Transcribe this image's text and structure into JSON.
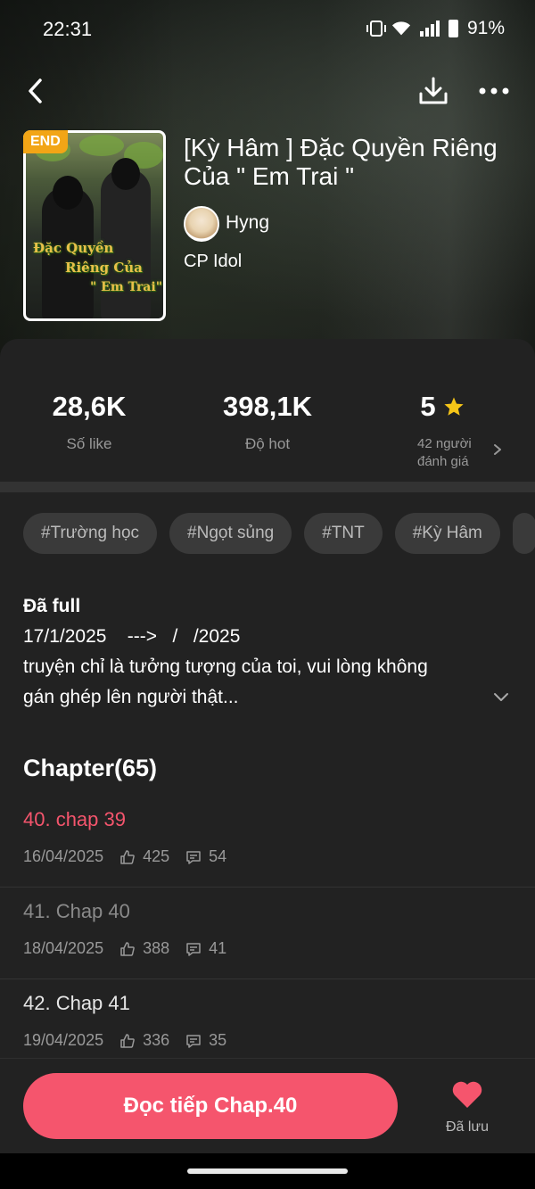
{
  "status_bar": {
    "time": "22:31",
    "battery": "91%"
  },
  "story": {
    "end_badge": "END",
    "cover_title_lines": [
      "Đặc Quyền",
      "Riêng Của",
      "\" Em Trai\""
    ],
    "title": "[Kỳ Hâm ] Đặc Quyền Riêng Của \" Em Trai \"",
    "author": "Hyng",
    "genre": "CP Idol"
  },
  "stats": {
    "likes": {
      "value": "28,6K",
      "label": "Số like"
    },
    "hot": {
      "value": "398,1K",
      "label": "Độ hot"
    },
    "rating": {
      "value": "5",
      "label_line1": "42 người",
      "label_line2": "đánh giá"
    }
  },
  "tags": [
    "#Trường học",
    "#Ngọt sủng",
    "#TNT",
    "#Kỳ Hâm"
  ],
  "description": {
    "line1": "Đã full",
    "line2": "17/1/2025    --->   /   /2025",
    "line3": "truyện chỉ là tưởng tượng của toi, vui lòng không",
    "line4": "gán ghép lên người thật..."
  },
  "chapters": {
    "heading": "Chapter(65)",
    "items": [
      {
        "title": "40. chap 39",
        "date": "16/04/2025",
        "likes": "425",
        "comments": "54",
        "color": "#f5556d"
      },
      {
        "title": "41. Chap 40",
        "date": "18/04/2025",
        "likes": "388",
        "comments": "41",
        "color": "#8a8a8a"
      },
      {
        "title": "42. Chap 41",
        "date": "19/04/2025",
        "likes": "336",
        "comments": "35",
        "color": "#e6e6e6"
      }
    ]
  },
  "bottom": {
    "read_button": "Đọc tiếp Chap.40",
    "saved_label": "Đã lưu"
  },
  "colors": {
    "accent": "#f5556d",
    "badge": "#f2a516",
    "star": "#f5c518",
    "sheet_bg": "#222222"
  },
  "icons": [
    "back-arrow-icon",
    "download-icon",
    "more-icon",
    "star-icon",
    "chevron-right-icon",
    "chevron-down-icon",
    "thumbs-up-icon",
    "comment-icon",
    "heart-icon"
  ]
}
